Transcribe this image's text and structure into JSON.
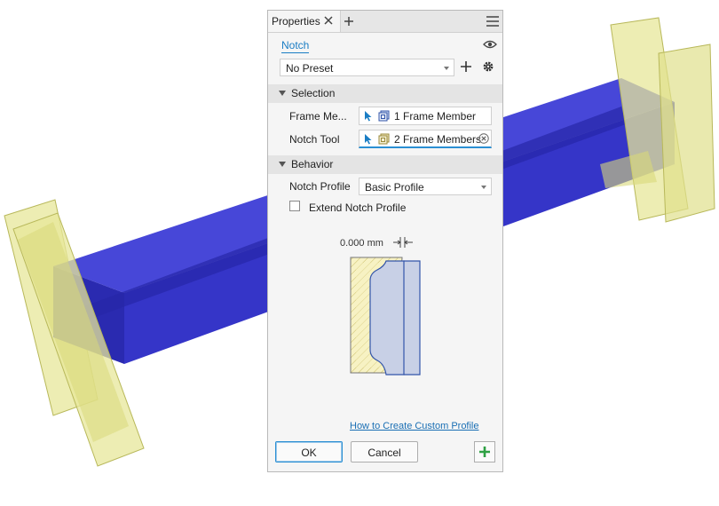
{
  "panel": {
    "tab_label": "Properties",
    "tool_name": "Notch",
    "preset_value": "No Preset"
  },
  "selection": {
    "header": "Selection",
    "frame_member_label": "Frame Me...",
    "frame_member_value": "1 Frame Member",
    "notch_tool_label": "Notch Tool",
    "notch_tool_value": "2 Frame Members"
  },
  "behavior": {
    "header": "Behavior",
    "notch_profile_label": "Notch Profile",
    "notch_profile_value": "Basic Profile",
    "extend_label": "Extend Notch Profile",
    "extend_checked": false,
    "offset_value": "0.000 mm"
  },
  "footer": {
    "help_link": "How to Create Custom Profile",
    "ok_label": "OK",
    "cancel_label": "Cancel"
  },
  "colors": {
    "accent": "#1a7dc4",
    "frame_member": "#3a3ad6",
    "notch_tool": "#e8e8a0",
    "apply_green": "#2ea043"
  }
}
